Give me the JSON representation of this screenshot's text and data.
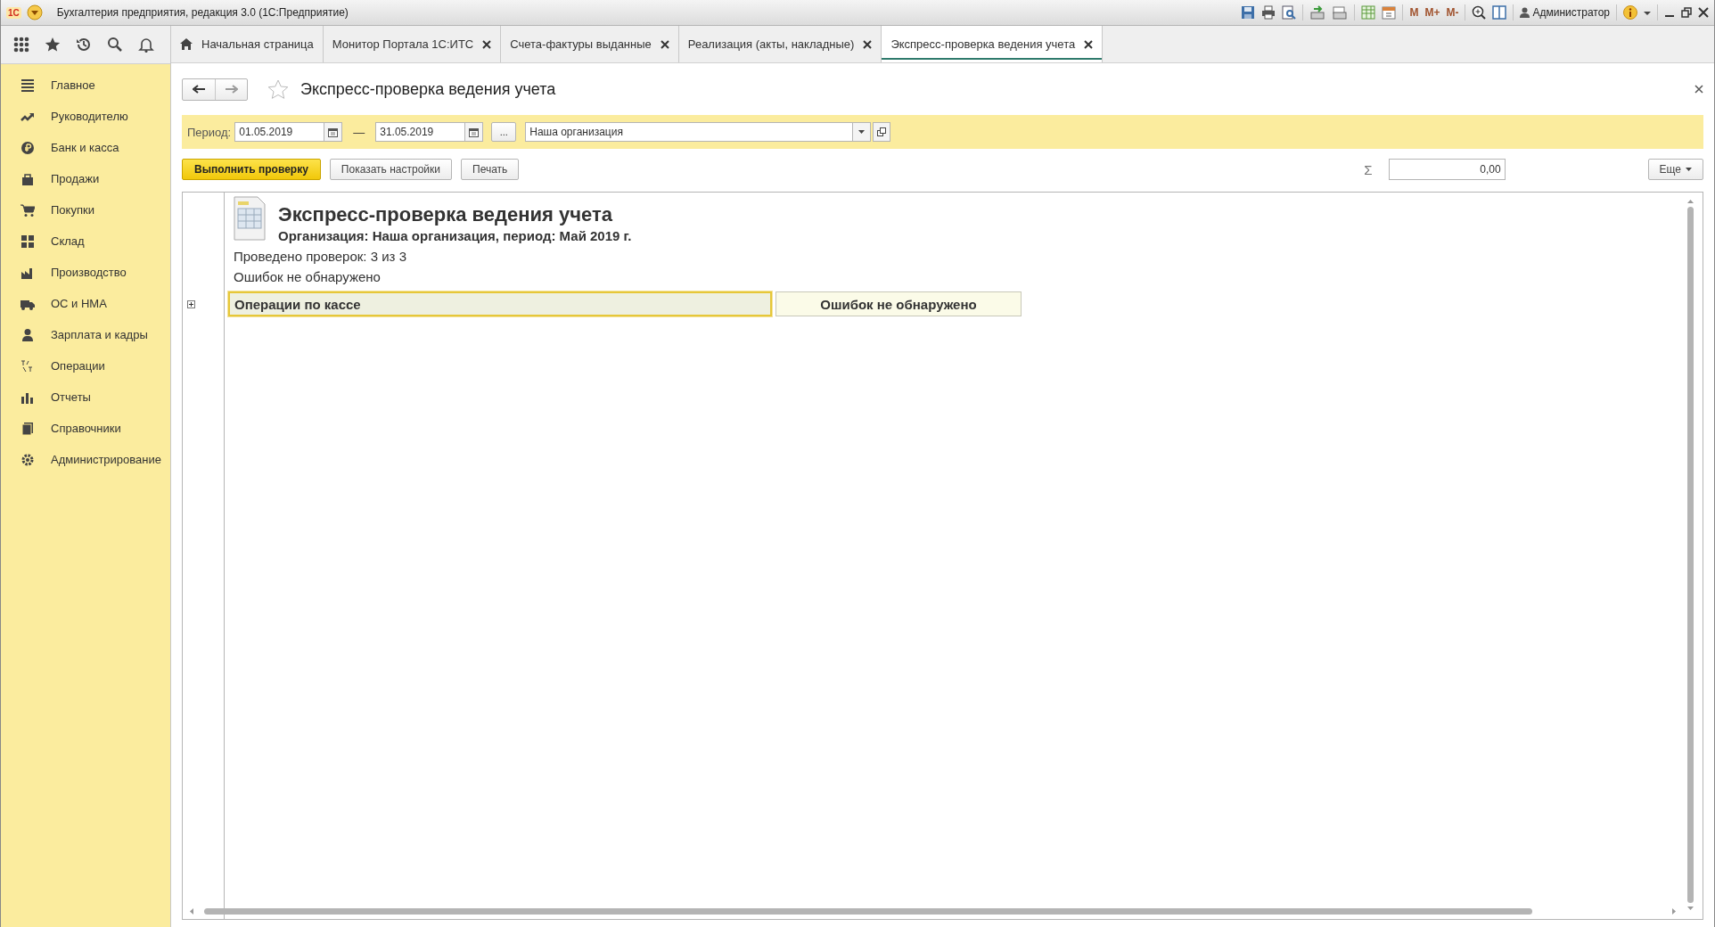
{
  "window": {
    "logo": "1С",
    "title": "Бухгалтерия предприятия, редакция 3.0  (1С:Предприятие)",
    "memory_buttons": [
      "M",
      "M+",
      "M-"
    ],
    "user": "Администратор"
  },
  "tabs": [
    {
      "label": "Начальная страница",
      "kind": "home",
      "selected": false
    },
    {
      "label": "Монитор Портала 1С:ИТС",
      "kind": "document",
      "selected": false
    },
    {
      "label": "Счета-фактуры выданные",
      "kind": "document",
      "selected": false
    },
    {
      "label": "Реализация (акты, накладные)",
      "kind": "document",
      "selected": false
    },
    {
      "label": "Экспресс-проверка ведения учета",
      "kind": "document",
      "selected": true
    }
  ],
  "sidebar": {
    "items": [
      {
        "label": "Главное",
        "selected": false
      },
      {
        "label": "Руководителю",
        "selected": false
      },
      {
        "label": "Банк и касса",
        "selected": false
      },
      {
        "label": "Продажи",
        "selected": false
      },
      {
        "label": "Покупки",
        "selected": false
      },
      {
        "label": "Склад",
        "selected": false
      },
      {
        "label": "Производство",
        "selected": false
      },
      {
        "label": "ОС и НМА",
        "selected": false
      },
      {
        "label": "Зарплата и кадры",
        "selected": false
      },
      {
        "label": "Операции",
        "selected": false
      },
      {
        "label": "Отчеты",
        "selected": false
      },
      {
        "label": "Справочники",
        "selected": false
      },
      {
        "label": "Администрирование",
        "selected": false
      }
    ]
  },
  "form": {
    "title": "Экспресс-проверка ведения учета",
    "favorite": false,
    "period_label": "Период:",
    "date_from": "01.05.2019",
    "date_separator": "—",
    "date_to": "31.05.2019",
    "period_button": "...",
    "organization": "Наша организация",
    "buttons": [
      {
        "label": "Выполнить проверку",
        "primary": true
      },
      {
        "label": "Показать настройки",
        "primary": false
      },
      {
        "label": "Печать",
        "primary": false
      }
    ],
    "sum_sign": "Σ",
    "sum": "0,00",
    "more": "Еще"
  },
  "report": {
    "title": "Экспресс-проверка ведения учета",
    "subtitle": "Организация: Наша организация, период: Май 2019 г.",
    "lines": [
      "Проведено проверок: 3 из 3",
      "Ошибок не обнаружено"
    ],
    "rows": [
      {
        "section": "Операции по кассе",
        "result": "Ошибок не обнаружено",
        "expanded": false,
        "selected": true
      }
    ]
  }
}
